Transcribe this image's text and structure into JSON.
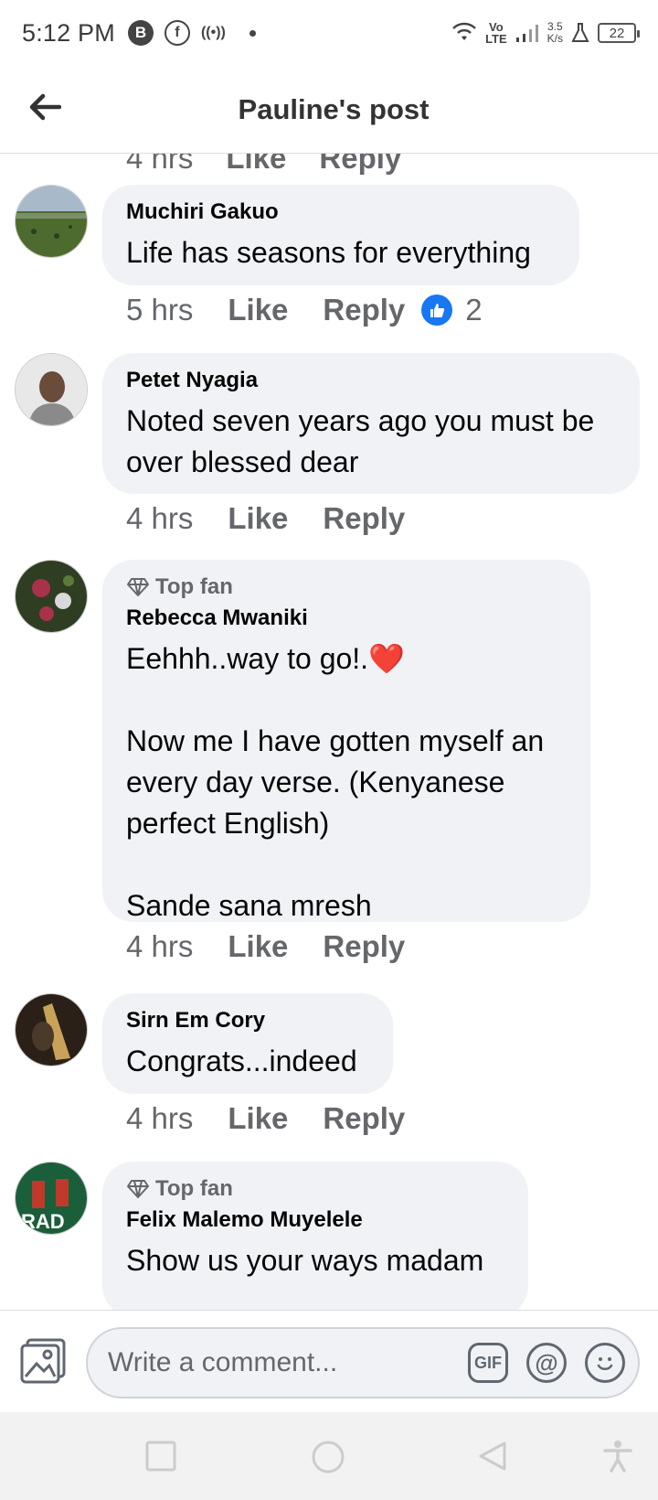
{
  "status_bar": {
    "time": "5:12 PM",
    "icons": [
      "b-app-icon",
      "facebook-icon",
      "hotspot-icon",
      "dot-icon",
      "wifi-icon",
      "volte-icon",
      "signal-icon",
      "flask-icon",
      "battery-icon"
    ],
    "volte_top": "Vo",
    "volte_bottom": "LTE",
    "speed_value": "3.5",
    "speed_unit": "K/s",
    "battery": "22"
  },
  "header": {
    "title": "Pauline's post"
  },
  "partial_previous_meta": {
    "time": "4 hrs",
    "like": "Like",
    "reply": "Reply"
  },
  "comments": [
    {
      "author": "Muchiri Gakuo",
      "text": "Life has seasons for everything",
      "time": "5 hrs",
      "like": "Like",
      "reply": "Reply",
      "reaction_count": "2",
      "avatar_colors": [
        "#7a8f6a",
        "#4d6b2e",
        "#a8b9c9"
      ]
    },
    {
      "author": "Petet Nyagia",
      "text": "Noted seven years ago you must be over blessed dear",
      "time": "4 hrs",
      "like": "Like",
      "reply": "Reply",
      "avatar_colors": [
        "#e8e8e8",
        "#6b4b3a",
        "#8a8a8a"
      ]
    },
    {
      "badge": "Top fan",
      "author": "Rebecca Mwaniki",
      "text": "Eehhh..way to go!.❤️\n\nNow me I have gotten myself an every day verse. (Kenyanese perfect English)\n\nSande sana mresh",
      "time": "4 hrs",
      "like": "Like",
      "reply": "Reply",
      "avatar_colors": [
        "#2f3d23",
        "#a8324a",
        "#d9d9d9"
      ]
    },
    {
      "author": "Sirn Em Cory",
      "text": "Congrats...indeed",
      "time": "4 hrs",
      "like": "Like",
      "reply": "Reply",
      "avatar_colors": [
        "#4a3a2a",
        "#c9a25a",
        "#2a2018"
      ]
    },
    {
      "badge": "Top fan",
      "author": "Felix Malemo Muyelele",
      "text": "Show us your ways madam",
      "avatar_colors": [
        "#1b5e3a",
        "#c0392b",
        "#ffffff"
      ],
      "avatar_text": "RAD"
    }
  ],
  "composer": {
    "placeholder": "Write a comment...",
    "gif_label": "GIF",
    "mention_label": "@"
  },
  "colors": {
    "bubble": "#f0f2f5",
    "meta_text": "#65676b",
    "like_blue": "#1877f2",
    "heart": "#e41e3f"
  }
}
